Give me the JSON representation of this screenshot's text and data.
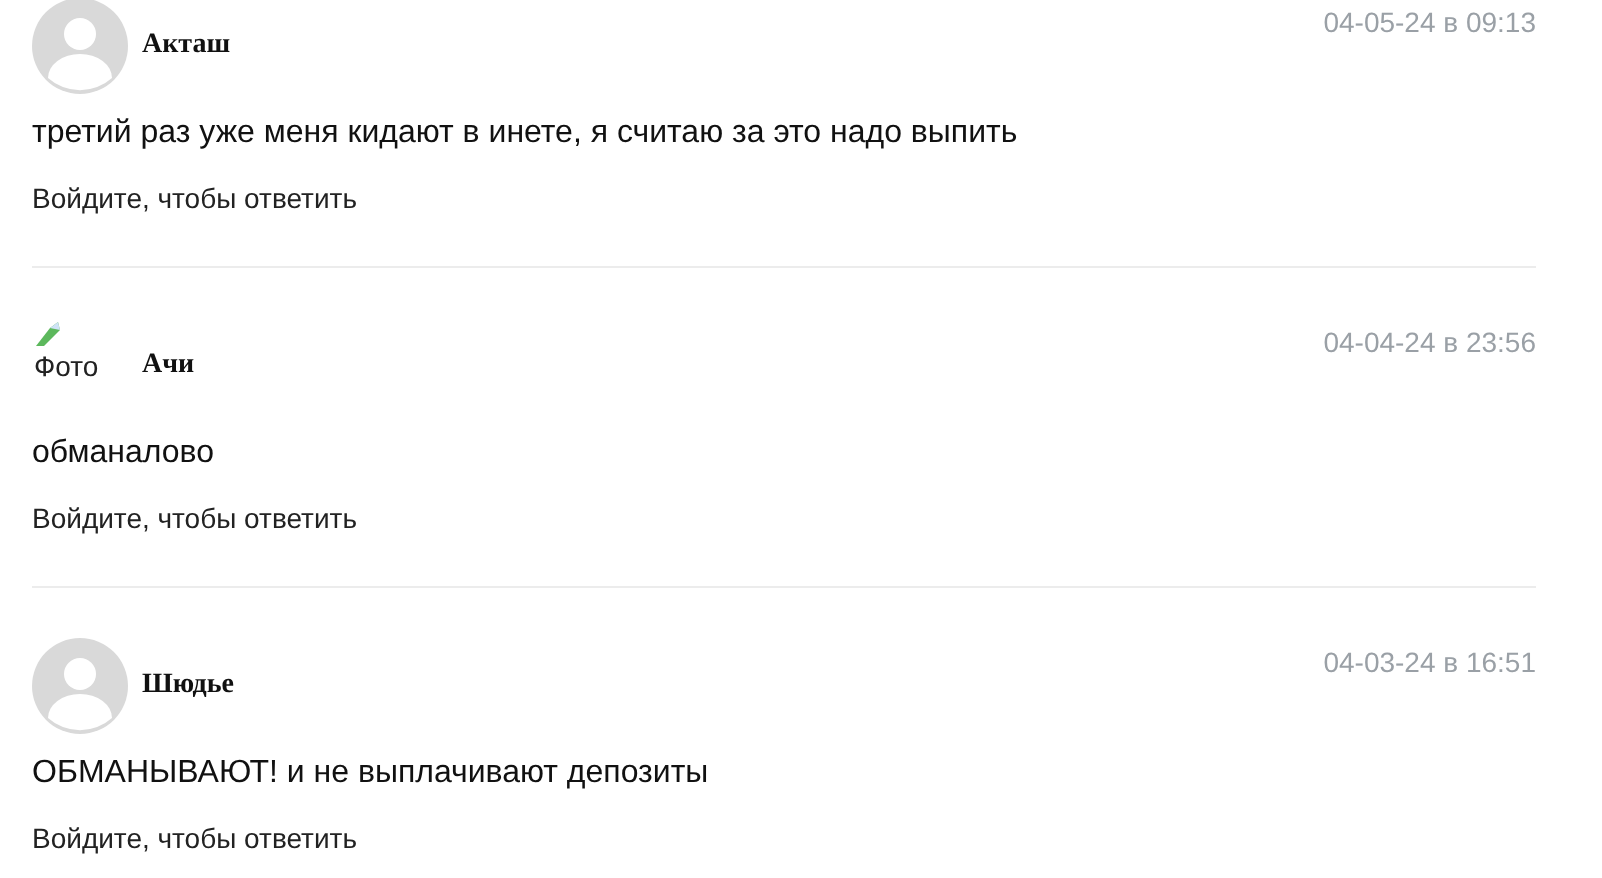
{
  "comments": [
    {
      "avatar": {
        "kind": "default"
      },
      "author": "Акташ",
      "date": "04-05-24 в 09:13",
      "text": "третий раз уже меня кидают в инете, я считаю за это надо выпить",
      "reply_link": "Войдите, чтобы ответить"
    },
    {
      "avatar": {
        "kind": "broken",
        "alt": "Фото"
      },
      "author": "Ачи",
      "date": "04-04-24 в 23:56",
      "text": "обманалово",
      "reply_link": "Войдите, чтобы ответить"
    },
    {
      "avatar": {
        "kind": "default"
      },
      "author": "Шюдье",
      "date": "04-03-24 в 16:51",
      "text": "ОБМАНЫВАЮТ! и не выплачивают депозиты",
      "reply_link": "Войдите, чтобы ответить"
    }
  ]
}
